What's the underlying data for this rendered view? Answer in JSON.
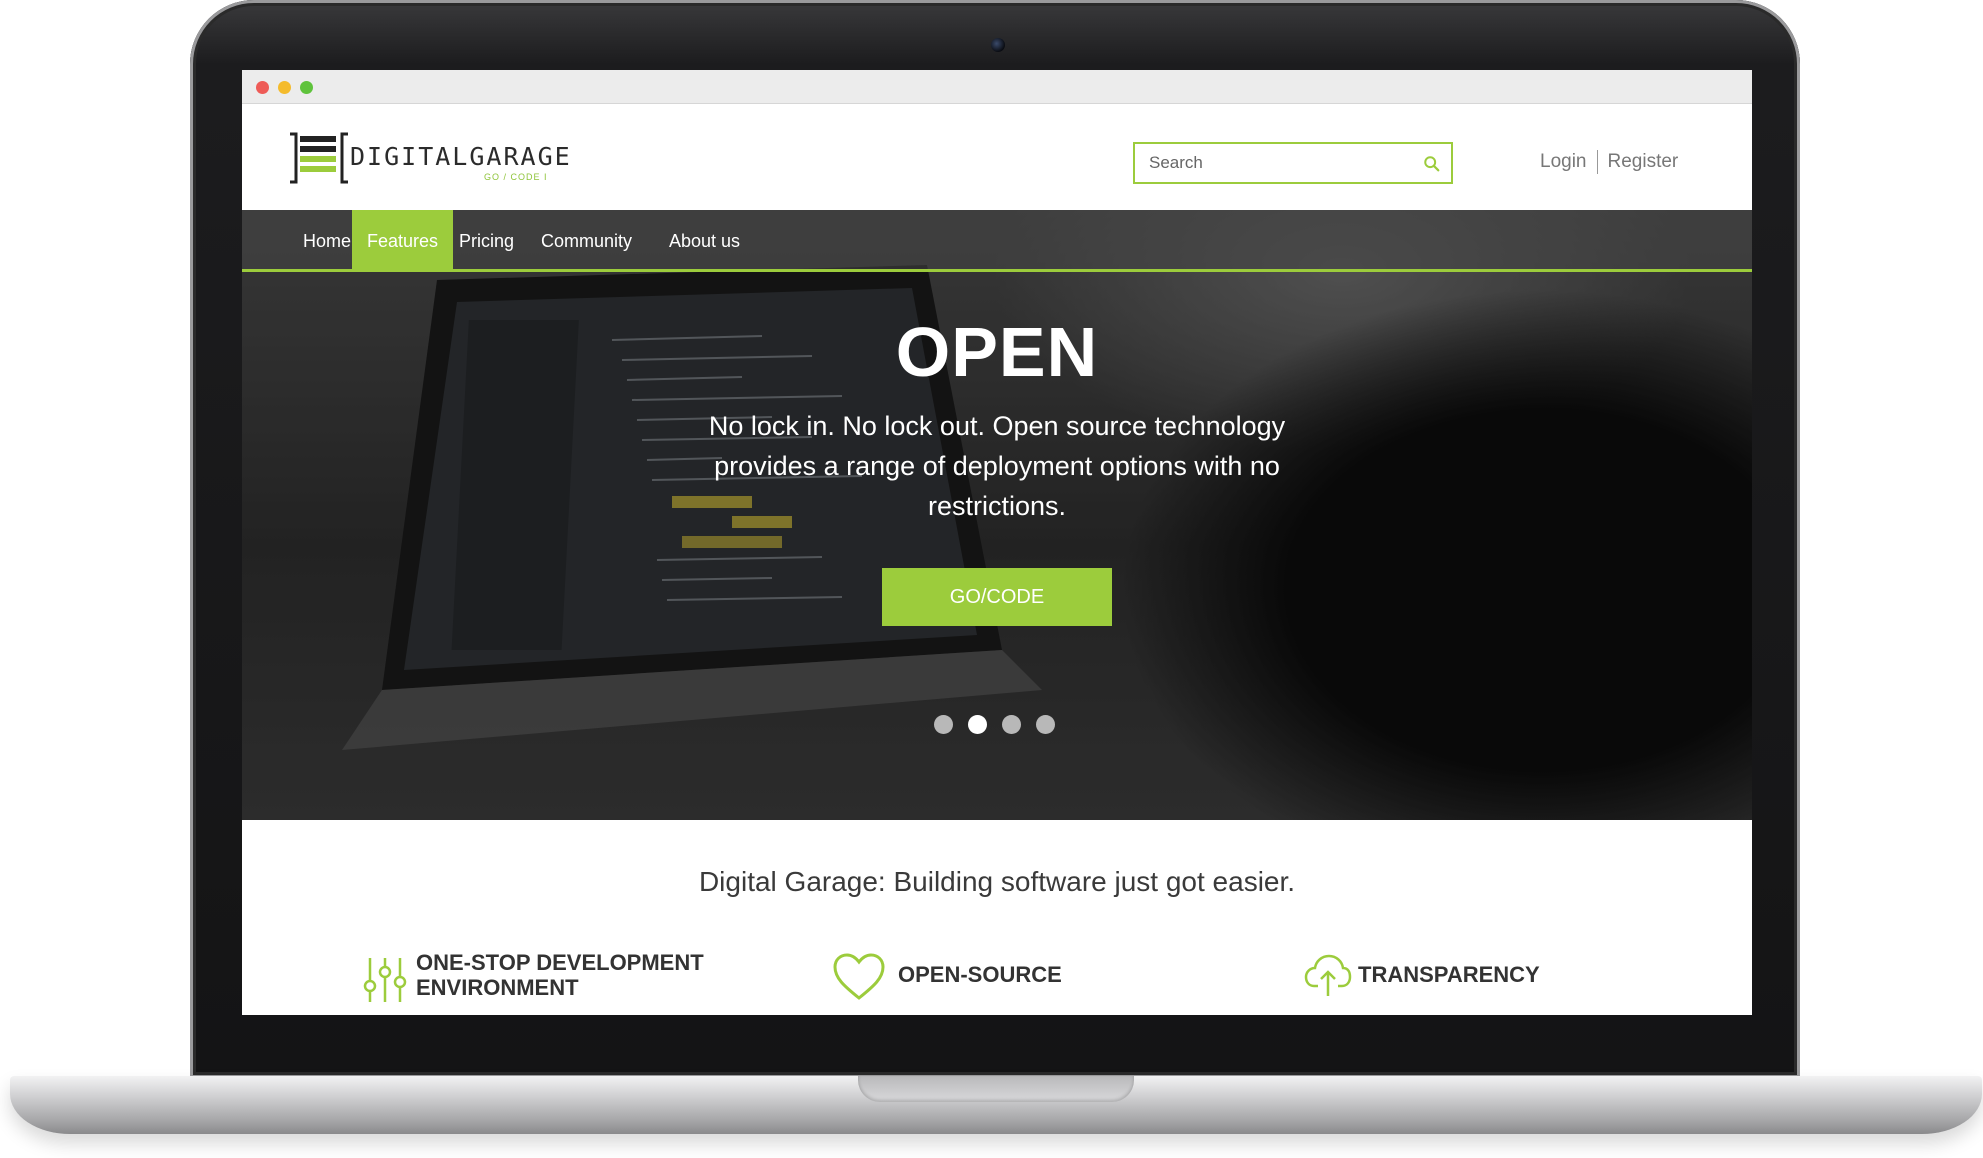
{
  "brand": {
    "name": "DIGITALGARAGE",
    "tagline": "GO / CODE I",
    "accent_color": "#9ccc3c"
  },
  "search": {
    "placeholder": "Search",
    "icon": "search-icon"
  },
  "auth": {
    "login": "Login",
    "register": "Register"
  },
  "nav": {
    "items": [
      {
        "label": "Home"
      },
      {
        "label": "Features",
        "active": true
      },
      {
        "label": "Pricing"
      },
      {
        "label": "Community"
      },
      {
        "label": "About us"
      }
    ]
  },
  "hero": {
    "title": "OPEN",
    "text": "No lock in. No lock out. Open source technology provides a range of deployment options with no restrictions.",
    "button": "GO/CODE",
    "slides": 4,
    "active_slide": 2
  },
  "tagline": "Digital Garage: Building software just got easier.",
  "features": [
    {
      "icon": "sliders-icon",
      "label_line1": "ONE-STOP DEVELOPMENT",
      "label_line2": "ENVIRONMENT"
    },
    {
      "icon": "heart-icon",
      "label_line1": "OPEN-SOURCE"
    },
    {
      "icon": "cloud-upload-icon",
      "label_line1": "TRANSPARENCY"
    }
  ]
}
